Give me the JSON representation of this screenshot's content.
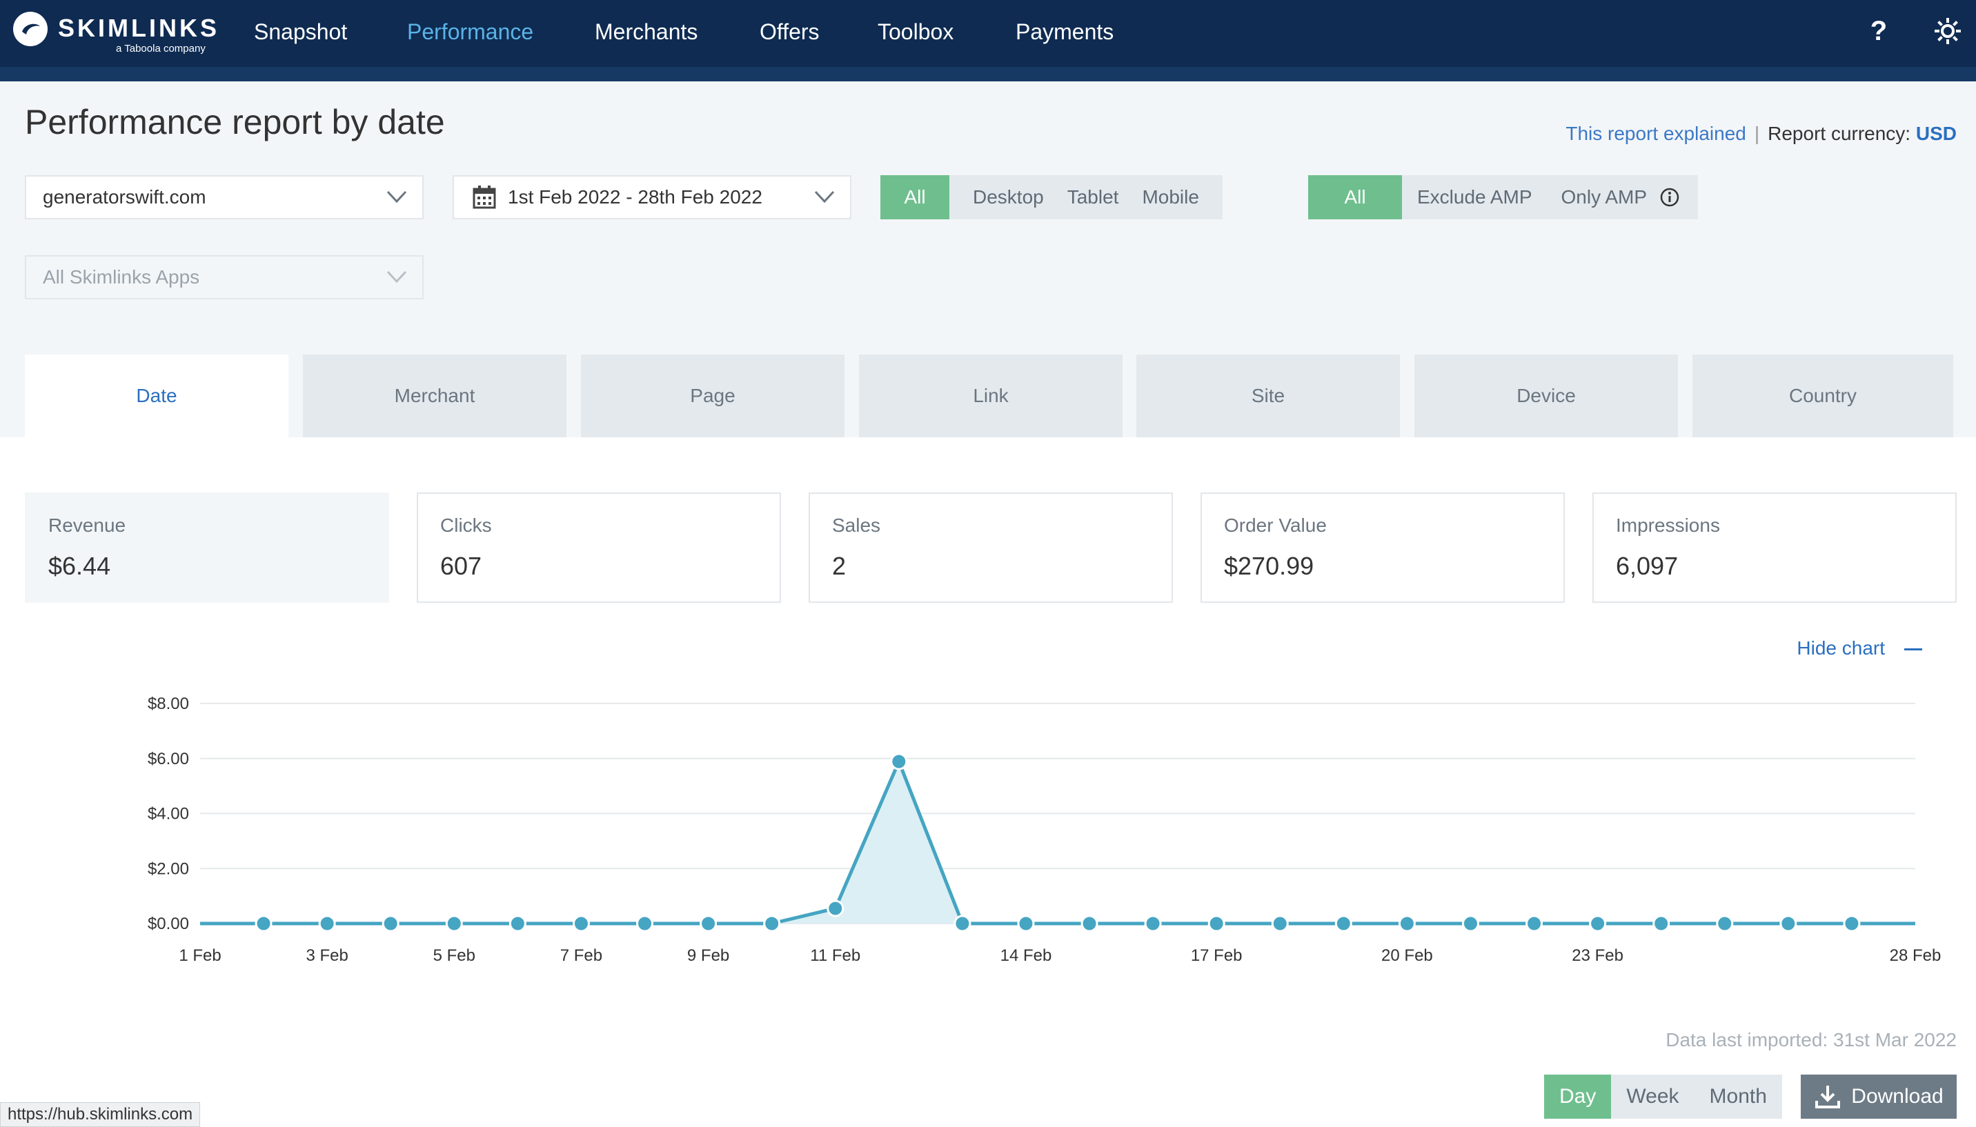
{
  "brand": {
    "name": "SKIMLINKS",
    "sub": "a Taboola company"
  },
  "nav": {
    "items": [
      "Snapshot",
      "Performance",
      "Merchants",
      "Offers",
      "Toolbox",
      "Payments"
    ],
    "active": "Performance",
    "icons": [
      "help-icon",
      "gear-icon"
    ]
  },
  "page": {
    "title": "Performance report by date",
    "report_explained": "This report explained",
    "currency_label": "Report currency:",
    "currency": "USD"
  },
  "filters": {
    "site": "generatorswift.com",
    "date_range": "1st Feb 2022 - 28th Feb 2022",
    "apps": "All Skimlinks Apps",
    "device": [
      "All",
      "Desktop",
      "Tablet",
      "Mobile"
    ],
    "device_selected": "All",
    "amp": [
      "All",
      "Exclude AMP",
      "Only AMP"
    ],
    "amp_selected": "All"
  },
  "tabs": [
    "Date",
    "Merchant",
    "Page",
    "Link",
    "Site",
    "Device",
    "Country"
  ],
  "active_tab": "Date",
  "metrics": [
    {
      "label": "Revenue",
      "value": "$6.44"
    },
    {
      "label": "Clicks",
      "value": "607"
    },
    {
      "label": "Sales",
      "value": "2"
    },
    {
      "label": "Order Value",
      "value": "$270.99"
    },
    {
      "label": "Impressions",
      "value": "6,097"
    }
  ],
  "hide_chart": "Hide chart",
  "chart_data": {
    "type": "area",
    "title": "",
    "xlabel": "",
    "ylabel": "",
    "x": [
      1,
      2,
      3,
      4,
      5,
      6,
      7,
      8,
      9,
      10,
      11,
      12,
      13,
      14,
      15,
      16,
      17,
      18,
      19,
      20,
      21,
      22,
      23,
      24,
      25,
      26,
      27,
      28
    ],
    "x_tick_labels": [
      {
        "x": 1,
        "label": "1 Feb"
      },
      {
        "x": 3,
        "label": "3 Feb"
      },
      {
        "x": 5,
        "label": "5 Feb"
      },
      {
        "x": 7,
        "label": "7 Feb"
      },
      {
        "x": 9,
        "label": "9 Feb"
      },
      {
        "x": 11,
        "label": "11 Feb"
      },
      {
        "x": 14,
        "label": "14 Feb"
      },
      {
        "x": 17,
        "label": "17 Feb"
      },
      {
        "x": 20,
        "label": "20 Feb"
      },
      {
        "x": 23,
        "label": "23 Feb"
      },
      {
        "x": 28,
        "label": "28 Feb"
      }
    ],
    "y_tick_labels": [
      "$0.00",
      "$2.00",
      "$4.00",
      "$6.00",
      "$8.00"
    ],
    "ylim": [
      0,
      8
    ],
    "series": [
      {
        "values": [
          0,
          0,
          0,
          0,
          0,
          0,
          0,
          0,
          0,
          0,
          0.55,
          5.89,
          0,
          0,
          0,
          0,
          0,
          0,
          0,
          0,
          0,
          0,
          0,
          0,
          0,
          0,
          0,
          0
        ]
      }
    ],
    "grid": true,
    "color": "#45a5c2"
  },
  "footer": {
    "last_imported": "Data last imported: 31st Mar 2022",
    "period": [
      "Day",
      "Week",
      "Month"
    ],
    "period_selected": "Day",
    "download": "Download"
  },
  "status_url": "https://hub.skimlinks.com"
}
